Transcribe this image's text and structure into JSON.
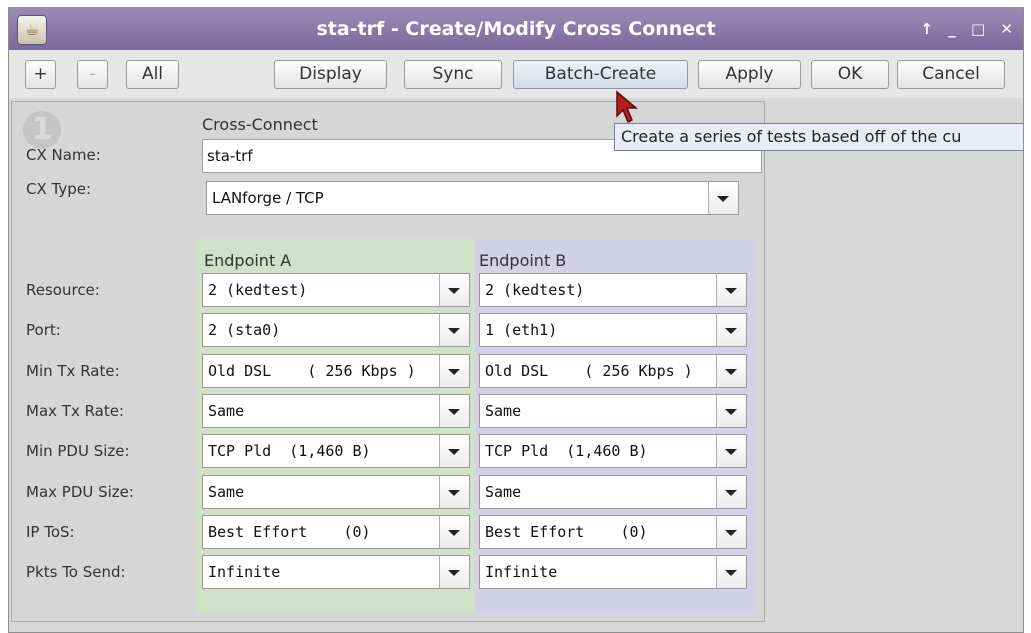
{
  "window": {
    "title": "sta-trf - Create/Modify Cross Connect",
    "controls": {
      "maximize": "↑",
      "minimize": "_",
      "restore": "□",
      "close": "✕"
    },
    "app_icon": "java-cup-icon"
  },
  "toolbar": {
    "add": "+",
    "remove": "-",
    "all": "All",
    "display": "Display",
    "sync": "Sync",
    "batch_create": "Batch-Create",
    "apply": "Apply",
    "ok": "OK",
    "cancel": "Cancel"
  },
  "tooltip": "Create a series of tests based off of the cu",
  "form": {
    "badge": "1",
    "section_title": "Cross-Connect",
    "cx_name_label": "CX Name:",
    "cx_name_value": "sta-trf",
    "cx_type_label": "CX Type:",
    "cx_type_value": "LANforge / TCP",
    "endpoint_a_header": "Endpoint A",
    "endpoint_b_header": "Endpoint B",
    "rows": [
      {
        "label": "Resource:",
        "a": "2 (kedtest)",
        "b": "2 (kedtest)"
      },
      {
        "label": "Port:",
        "a": "2 (sta0)",
        "b": "1 (eth1)"
      },
      {
        "label": "Min Tx Rate:",
        "a": "Old DSL    ( 256 Kbps )",
        "b": "Old DSL    ( 256 Kbps )"
      },
      {
        "label": "Max Tx Rate:",
        "a": "Same",
        "b": "Same"
      },
      {
        "label": "Min PDU Size:",
        "a": "TCP Pld  (1,460 B)",
        "b": "TCP Pld  (1,460 B)"
      },
      {
        "label": "Max PDU Size:",
        "a": "Same",
        "b": "Same"
      },
      {
        "label": "IP ToS:",
        "a": "Best Effort    (0)",
        "b": "Best Effort    (0)"
      },
      {
        "label": "Pkts To Send:",
        "a": "Infinite",
        "b": "Infinite"
      }
    ]
  },
  "colors": {
    "titlebar": "#8a7aaa",
    "endpoint_a_bg": "#cfe1c7",
    "endpoint_b_bg": "#d2d1e8"
  }
}
